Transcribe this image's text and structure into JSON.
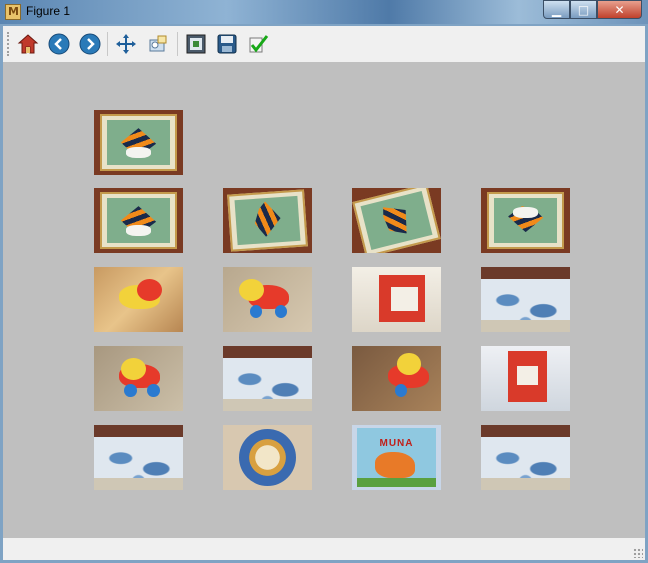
{
  "window": {
    "title": "Figure 1",
    "controls": {
      "minimize": "▁",
      "maximize": "□",
      "close": "✕"
    }
  },
  "toolbar": {
    "items": [
      {
        "name": "home",
        "icon": "home-icon"
      },
      {
        "name": "back",
        "icon": "back-arrow-icon"
      },
      {
        "name": "forward",
        "icon": "forward-arrow-icon"
      },
      {
        "name": "pan",
        "icon": "move-icon"
      },
      {
        "name": "zoom",
        "icon": "zoom-rect-icon"
      },
      {
        "name": "subplots",
        "icon": "subplots-icon"
      },
      {
        "name": "save",
        "icon": "floppy-disk-icon"
      },
      {
        "name": "edit",
        "icon": "checkmark-icon"
      }
    ]
  },
  "figure": {
    "rows": [
      [
        "fish"
      ],
      [
        "fish",
        "fish-tilted",
        "fish-rotated",
        "fish"
      ],
      [
        "toy",
        "toy",
        "box",
        "cloth"
      ],
      [
        "toy",
        "cloth",
        "toy",
        "box"
      ],
      [
        "cloth",
        "disc",
        "book",
        "cloth"
      ]
    ],
    "book_cover_text": "MUNA"
  },
  "colors": {
    "canvas_bg": "#bfbfbf",
    "toolbar_bg": "#f0f0f0",
    "titlebar_accent": "#6d93ba"
  }
}
